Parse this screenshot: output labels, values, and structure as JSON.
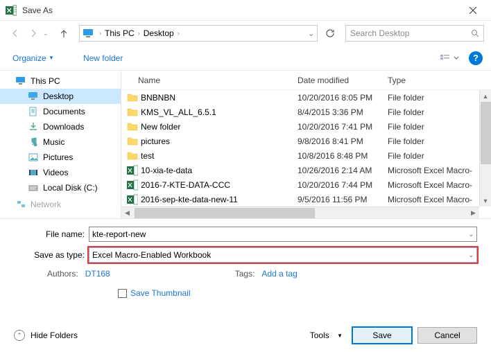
{
  "title": "Save As",
  "path": {
    "seg1": "This PC",
    "seg2": "Desktop"
  },
  "search": {
    "placeholder": "Search Desktop"
  },
  "toolbar": {
    "organize": "Organize",
    "newfolder": "New folder"
  },
  "sidebar": {
    "thispc": "This PC",
    "desktop": "Desktop",
    "documents": "Documents",
    "downloads": "Downloads",
    "music": "Music",
    "pictures": "Pictures",
    "videos": "Videos",
    "localdisk": "Local Disk (C:)",
    "network": "Network"
  },
  "cols": {
    "name": "Name",
    "date": "Date modified",
    "type": "Type"
  },
  "files": [
    {
      "name": "BNBNBN",
      "date": "10/20/2016 8:05 PM",
      "type": "File folder",
      "kind": "folder"
    },
    {
      "name": "KMS_VL_ALL_6.5.1",
      "date": "8/4/2015 3:36 PM",
      "type": "File folder",
      "kind": "folder"
    },
    {
      "name": "New folder",
      "date": "10/20/2016 7:41 PM",
      "type": "File folder",
      "kind": "folder"
    },
    {
      "name": "pictures",
      "date": "9/8/2016 8:41 PM",
      "type": "File folder",
      "kind": "folder"
    },
    {
      "name": "test",
      "date": "10/8/2016 8:48 PM",
      "type": "File folder",
      "kind": "folder"
    },
    {
      "name": "10-xia-te-data",
      "date": "10/26/2016 2:14 AM",
      "type": "Microsoft Excel Macro-",
      "kind": "xlsm"
    },
    {
      "name": "2016-7-KTE-DATA-CCC",
      "date": "10/20/2016 7:44 PM",
      "type": "Microsoft Excel Macro-",
      "kind": "xlsm"
    },
    {
      "name": "2016-sep-kte-data-new-11",
      "date": "9/5/2016 11:56 PM",
      "type": "Microsoft Excel Macro-",
      "kind": "xlsm"
    }
  ],
  "filename": {
    "label": "File name:",
    "value": "kte-report-new"
  },
  "savetype": {
    "label": "Save as type:",
    "value": "Excel Macro-Enabled Workbook"
  },
  "meta": {
    "authors_label": "Authors:",
    "authors_value": "DT168",
    "tags_label": "Tags:",
    "tags_value": "Add a tag"
  },
  "thumb": "Save Thumbnail",
  "footer": {
    "hide": "Hide Folders",
    "tools": "Tools",
    "save": "Save",
    "cancel": "Cancel"
  }
}
